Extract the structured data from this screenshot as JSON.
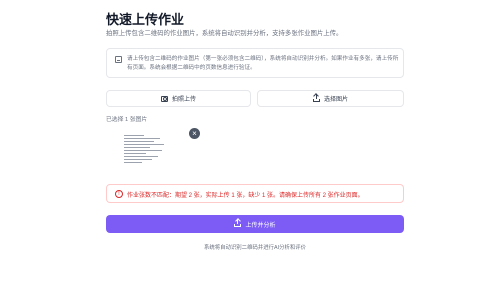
{
  "header": {
    "title": "快速上传作业",
    "subtitle": "拍照上传包含二维码的作业图片，系统将自动识别并分析，支持多张作业图片上传。"
  },
  "notice": {
    "icon": "image-icon",
    "text": "请上传包含二维码的作业图片（第一张必须包含二维码），系统将自动识别并分析。如果作业有多张，请上传所有页面。系统会根据二维码中的页数信息进行验证。"
  },
  "actions": {
    "camera_label": "拍照上传",
    "select_label": "选择图片"
  },
  "selection": {
    "count_text": "已选择 1 张图片"
  },
  "error": {
    "text": "作业张数不匹配：期望 2 张，实际上传 1 张，缺少 1 张。请确保上传所有 2 张作业页面。",
    "color": "#dc2626"
  },
  "submit": {
    "label": "上传并分析",
    "color": "#7c5cf5"
  },
  "footer": {
    "text": "系统将自动识别二维码并进行AI分析和评价"
  }
}
